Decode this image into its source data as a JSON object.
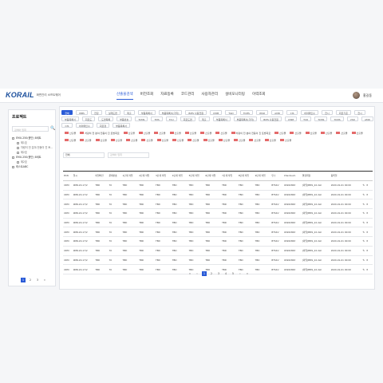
{
  "header": {
    "logo": "KORAIL",
    "logo_sub": "화면관리 소프트웨어",
    "nav": [
      "산출물검색",
      "버전조회",
      "자료등록",
      "코드관리",
      "사용자관리",
      "설비모니터링",
      "이력조회"
    ],
    "user_name": "홍길동"
  },
  "side": {
    "title": "프로젝트",
    "search_placeholder": "검색어 입력",
    "search_btn": "🔍",
    "tree": [
      {
        "label": "EMU-250(중단) 8세트",
        "level": 0
      },
      {
        "label": "제1호",
        "level": 1
      },
      {
        "label": "차량이 전 분야 전동이 진 토...",
        "level": 1
      },
      {
        "label": "제2호",
        "level": 1
      },
      {
        "label": "EMU-250(중단) 8세트",
        "level": 0
      },
      {
        "label": "제2호",
        "level": 1
      },
      {
        "label": "테스트ABC",
        "level": 0
      }
    ],
    "pages": [
      "1",
      "2",
      "3",
      "»"
    ]
  },
  "chips": [
    "전체",
    "WBS",
    "전장",
    "설계도면",
    "제출",
    "부품목록서",
    "부품목록서(기타)",
    "BMS 사용전원",
    "CMM",
    "TGD",
    "TCMS",
    "WSD",
    "AMD",
    "CIS",
    "하의메인수",
    "전시",
    "회로기준",
    "전시",
    "부품목록서",
    "회로도",
    "도면목록",
    "부품번호",
    "TCMS",
    "TMS",
    "TCU",
    "회로도면",
    "제출",
    "부품목록서",
    "부품목록서(기타)",
    "BMS 사용전원",
    "CMM",
    "TCD",
    "TCMS",
    "TCMS",
    "VSD",
    "AMD",
    "CIS",
    "하의메인수",
    "회로정",
    "부품목록서"
  ],
  "tags": [
    "산출물",
    "차량이 전 분야 전동이 진 토방회로",
    "산출물",
    "산출물",
    "산출물",
    "산출물",
    "산출물",
    "산출물",
    "산출물",
    "차량이 전 분야 전동이 진 토방회로",
    "산출물",
    "산출물",
    "산출물",
    "산출물",
    "산출물",
    "산출물",
    "산출물",
    "산출물",
    "산출물",
    "산출물",
    "산출물",
    "산출물",
    "산출물",
    "산출물",
    "산출물",
    "산출물",
    "산출물",
    "산출물",
    "산출물",
    "산출물",
    "산출물"
  ],
  "filter": {
    "select1": "전체",
    "select2_placeholder": "검색어 입력"
  },
  "table": {
    "headers": [
      "PCN",
      "일시",
      "파일버전",
      "문제번호",
      "1단계 작업",
      "2단계 작업",
      "3단계 작업",
      "4단계 작업",
      "5단계 작업",
      "6단계 작업",
      "7단계 작업",
      "8단계 작업",
      "9단계 작업",
      "인수",
      "Checksum",
      "결함위험",
      "등록일"
    ],
    "rows": [
      [
        "XDM",
        "9MR-20-17/2",
        "TBD",
        "70",
        "TBD",
        "TBD",
        "TBD",
        "TBD",
        "TBD",
        "TBD",
        "TBD",
        "TBD",
        "TBD",
        "BTS4V",
        "4h99C863",
        "[파일]BMS_22.dat",
        "2020-01-01 00:00"
      ],
      [
        "XDM",
        "9MR-20-17/2",
        "TBD",
        "70",
        "TBD",
        "TBD",
        "TBD",
        "TBD",
        "TBD",
        "TBD",
        "TBD",
        "TBD",
        "TBD",
        "BTS4V",
        "4h99C863",
        "[파일]BMS_22.dat",
        "2020-01-01 00:00"
      ],
      [
        "XDM",
        "9MR-20-17/2",
        "TBD",
        "70",
        "TBD",
        "TBD",
        "TBD",
        "TBD",
        "TBD",
        "TBD",
        "TBD",
        "TBD",
        "TBD",
        "BTS4V",
        "4h99C863",
        "[파일]BMS_22.dat",
        "2020-01-01 00:00"
      ],
      [
        "XDM",
        "9MR-20-17/2",
        "TBD",
        "70",
        "TBD",
        "TBD",
        "TBD",
        "TBD",
        "TBD",
        "TBD",
        "TBD",
        "TBD",
        "TBD",
        "BTS4V",
        "4h99C863",
        "[파일]BMS_22.dat",
        "2020-01-01 00:00"
      ],
      [
        "XDM",
        "9MR-20-17/2",
        "TBD",
        "70",
        "TBD",
        "TBD",
        "TBD",
        "TBD",
        "TBD",
        "TBD",
        "TBD",
        "TBD",
        "TBD",
        "BTS4V",
        "4h99C863",
        "[파일]BMS_22.dat",
        "2020-01-01 00:00"
      ],
      [
        "XDM",
        "9MR-20-17/2",
        "TBD",
        "70",
        "TBD",
        "TBD",
        "TBD",
        "TBD",
        "TBD",
        "TBD",
        "TBD",
        "TBD",
        "TBD",
        "BTS4V",
        "4h99C863",
        "[파일]BMS_22.dat",
        "2020-01-01 00:00"
      ],
      [
        "XDM",
        "9MR-20-17/2",
        "TBD",
        "70",
        "TBD",
        "TBD",
        "TBD",
        "TBD",
        "TBD",
        "TBD",
        "TBD",
        "TBD",
        "TBD",
        "BTS4V",
        "4h99C863",
        "[파일]BMS_22.dat",
        "2020-01-01 00:00"
      ],
      [
        "XDM",
        "9MR-20-17/2",
        "TBD",
        "70",
        "TBD",
        "TBD",
        "TBD",
        "TBD",
        "TBD",
        "TBD",
        "TBD",
        "TBD",
        "TBD",
        "BTS4V",
        "4h99C863",
        "[파일]BMS_22.dat",
        "2020-01-01 00:00"
      ],
      [
        "XDM",
        "9MR-20-17/2",
        "TBD",
        "70",
        "TBD",
        "TBD",
        "TBD",
        "TBD",
        "TBD",
        "TBD",
        "TBD",
        "TBD",
        "TBD",
        "BTS4V",
        "4h99C863",
        "[파일]BMS_22.dat",
        "2020-01-01 00:00"
      ],
      [
        "XDM",
        "9MR-20-17/2",
        "TBD",
        "70",
        "TBD",
        "TBD",
        "TBD",
        "TBD",
        "TBD",
        "TBD",
        "TBD",
        "TBD",
        "TBD",
        "BTS4V",
        "4h99C863",
        "[파일]BMS_22.dat",
        "2020-01-01 00:00"
      ]
    ],
    "edit_icon": "✎",
    "delete_icon": "✕"
  },
  "pagination": [
    "«",
    "‹",
    "1",
    "2",
    "3",
    "4",
    "5",
    "›",
    "»"
  ],
  "colors": {
    "accent": "#2a5bd7",
    "brand": "#1b4f9c",
    "tag": "#e46a6a"
  }
}
